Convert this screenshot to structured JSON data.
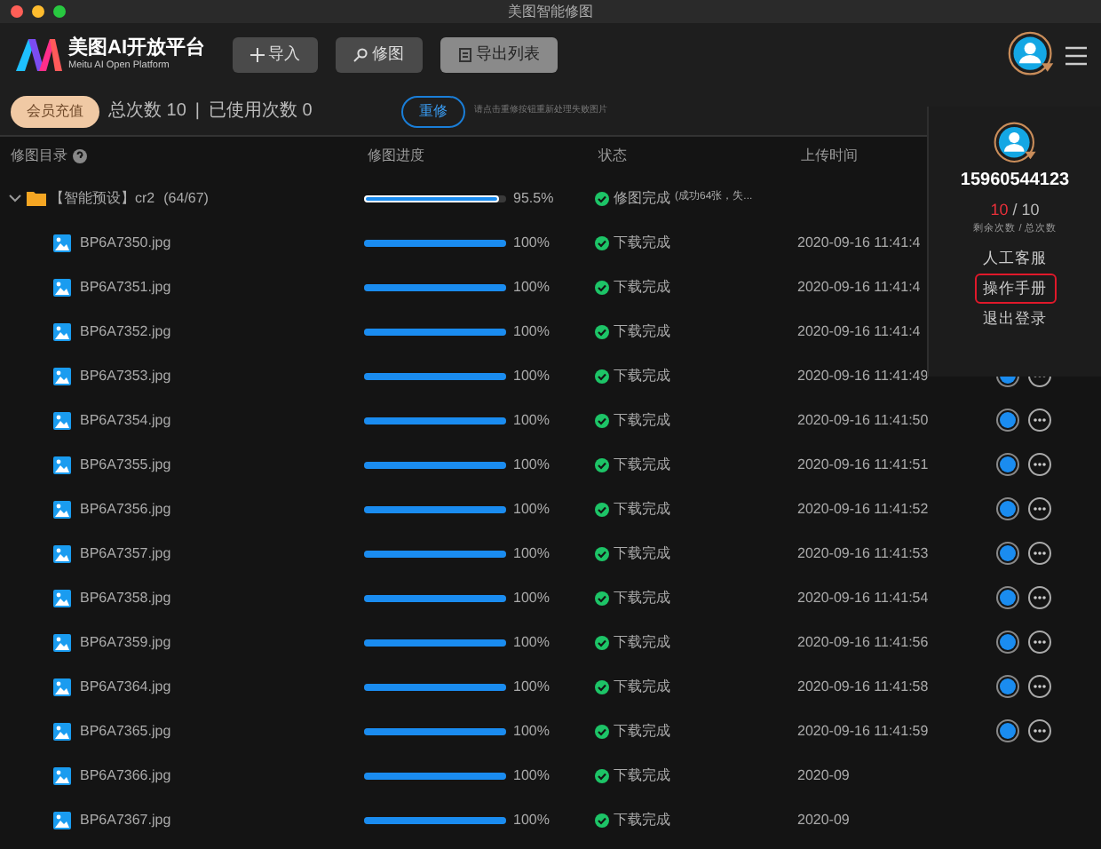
{
  "window": {
    "title": "美图智能修图"
  },
  "brand": {
    "name": "美图AI开放平台",
    "subtitle": "Meitu AI Open Platform"
  },
  "toolbar": [
    "导入",
    "修图",
    "导出列表"
  ],
  "account_bar": {
    "recharge": "会员充值",
    "total": "总次数 10",
    "separator": "|",
    "used": "已使用次数 0",
    "retry": "重修",
    "hint": "请点击重修按钮重新处理失败图片"
  },
  "columns": [
    "修图目录",
    "修图进度",
    "状态",
    "上传时间"
  ],
  "group": {
    "name": "【智能预设】cr2",
    "count": "(64/67)",
    "expanded": true,
    "level": 0.955,
    "percent": "95.5%",
    "status": "修图完成",
    "detail": "(成功64张，失..."
  },
  "rows": [
    {
      "name": "BP6A7350.jpg",
      "level": 1,
      "percent": "100%",
      "status": "下载完成",
      "time": "2020-09-16 11:41:4",
      "actions": false
    },
    {
      "name": "BP6A7351.jpg",
      "level": 1,
      "percent": "100%",
      "status": "下载完成",
      "time": "2020-09-16 11:41:4",
      "actions": false
    },
    {
      "name": "BP6A7352.jpg",
      "level": 1,
      "percent": "100%",
      "status": "下载完成",
      "time": "2020-09-16 11:41:4",
      "actions": false
    },
    {
      "name": "BP6A7353.jpg",
      "level": 1,
      "percent": "100%",
      "status": "下载完成",
      "time": "2020-09-16 11:41:49",
      "actions": true
    },
    {
      "name": "BP6A7354.jpg",
      "level": 1,
      "percent": "100%",
      "status": "下载完成",
      "time": "2020-09-16 11:41:50",
      "actions": true
    },
    {
      "name": "BP6A7355.jpg",
      "level": 1,
      "percent": "100%",
      "status": "下载完成",
      "time": "2020-09-16 11:41:51",
      "actions": true
    },
    {
      "name": "BP6A7356.jpg",
      "level": 1,
      "percent": "100%",
      "status": "下载完成",
      "time": "2020-09-16 11:41:52",
      "actions": true
    },
    {
      "name": "BP6A7357.jpg",
      "level": 1,
      "percent": "100%",
      "status": "下载完成",
      "time": "2020-09-16 11:41:53",
      "actions": true
    },
    {
      "name": "BP6A7358.jpg",
      "level": 1,
      "percent": "100%",
      "status": "下载完成",
      "time": "2020-09-16 11:41:54",
      "actions": true
    },
    {
      "name": "BP6A7359.jpg",
      "level": 1,
      "percent": "100%",
      "status": "下载完成",
      "time": "2020-09-16 11:41:56",
      "actions": true
    },
    {
      "name": "BP6A7364.jpg",
      "level": 1,
      "percent": "100%",
      "status": "下载完成",
      "time": "2020-09-16 11:41:58",
      "actions": true
    },
    {
      "name": "BP6A7365.jpg",
      "level": 1,
      "percent": "100%",
      "status": "下载完成",
      "time": "2020-09-16 11:41:59",
      "actions": true
    },
    {
      "name": "BP6A7366.jpg",
      "level": 1,
      "percent": "100%",
      "status": "下载完成",
      "time": "2020-09",
      "actions": false
    },
    {
      "name": "BP6A7367.jpg",
      "level": 1,
      "percent": "100%",
      "status": "下载完成",
      "time": "2020-09",
      "actions": false
    }
  ],
  "user_menu": {
    "phone": "15960544123",
    "remaining": "10",
    "sep": "/",
    "total": "10",
    "counts_label": "剩余次数 / 总次数",
    "items": [
      {
        "label": "人工客服",
        "highlighted": false
      },
      {
        "label": "操作手册",
        "highlighted": true
      },
      {
        "label": "退出登录",
        "highlighted": false
      }
    ]
  }
}
